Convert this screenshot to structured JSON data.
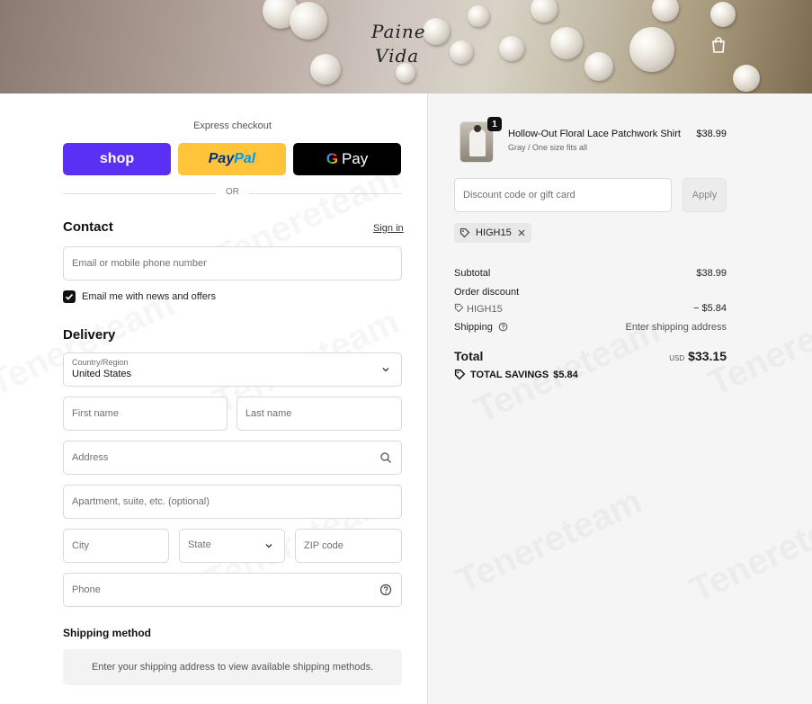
{
  "header": {
    "logo_line1": "Paine",
    "logo_line2": "Vida"
  },
  "express": {
    "title": "Express checkout",
    "shop_label": "shop",
    "paypal_part1": "Pay",
    "paypal_part2": "Pal",
    "gpay_g": "G",
    "gpay_label": "Pay",
    "divider": "OR"
  },
  "contact": {
    "heading": "Contact",
    "signin": "Sign in",
    "email_placeholder": "Email or mobile phone number",
    "newsletter_label": "Email me with news and offers",
    "newsletter_checked": true
  },
  "delivery": {
    "heading": "Delivery",
    "country_label": "Country/Region",
    "country_value": "United States",
    "first_name": "First name",
    "last_name": "Last name",
    "address": "Address",
    "apartment": "Apartment, suite, etc. (optional)",
    "city": "City",
    "state": "State",
    "zip": "ZIP code",
    "phone": "Phone"
  },
  "shipping": {
    "heading": "Shipping method",
    "message": "Enter your shipping address to view available shipping methods."
  },
  "summary": {
    "item": {
      "quantity": "1",
      "name": "Hollow-Out Floral Lace Patchwork Shirt",
      "variant": "Gray / One size fits all",
      "price": "$38.99"
    },
    "discount_placeholder": "Discount code or gift card",
    "apply_label": "Apply",
    "applied_code": "HIGH15",
    "subtotal_label": "Subtotal",
    "subtotal_value": "$38.99",
    "order_discount_label": "Order discount",
    "discount_code": "HIGH15",
    "discount_value": "− $5.84",
    "shipping_label": "Shipping",
    "shipping_value": "Enter shipping address",
    "total_label": "Total",
    "currency": "USD",
    "total_value": "$33.15",
    "savings_label": "TOTAL SAVINGS",
    "savings_value": "$5.84"
  },
  "watermark": "Tenereteam",
  "colors": {
    "shop": "#5a31f4",
    "paypal": "#ffc439",
    "gpay": "#000000"
  }
}
